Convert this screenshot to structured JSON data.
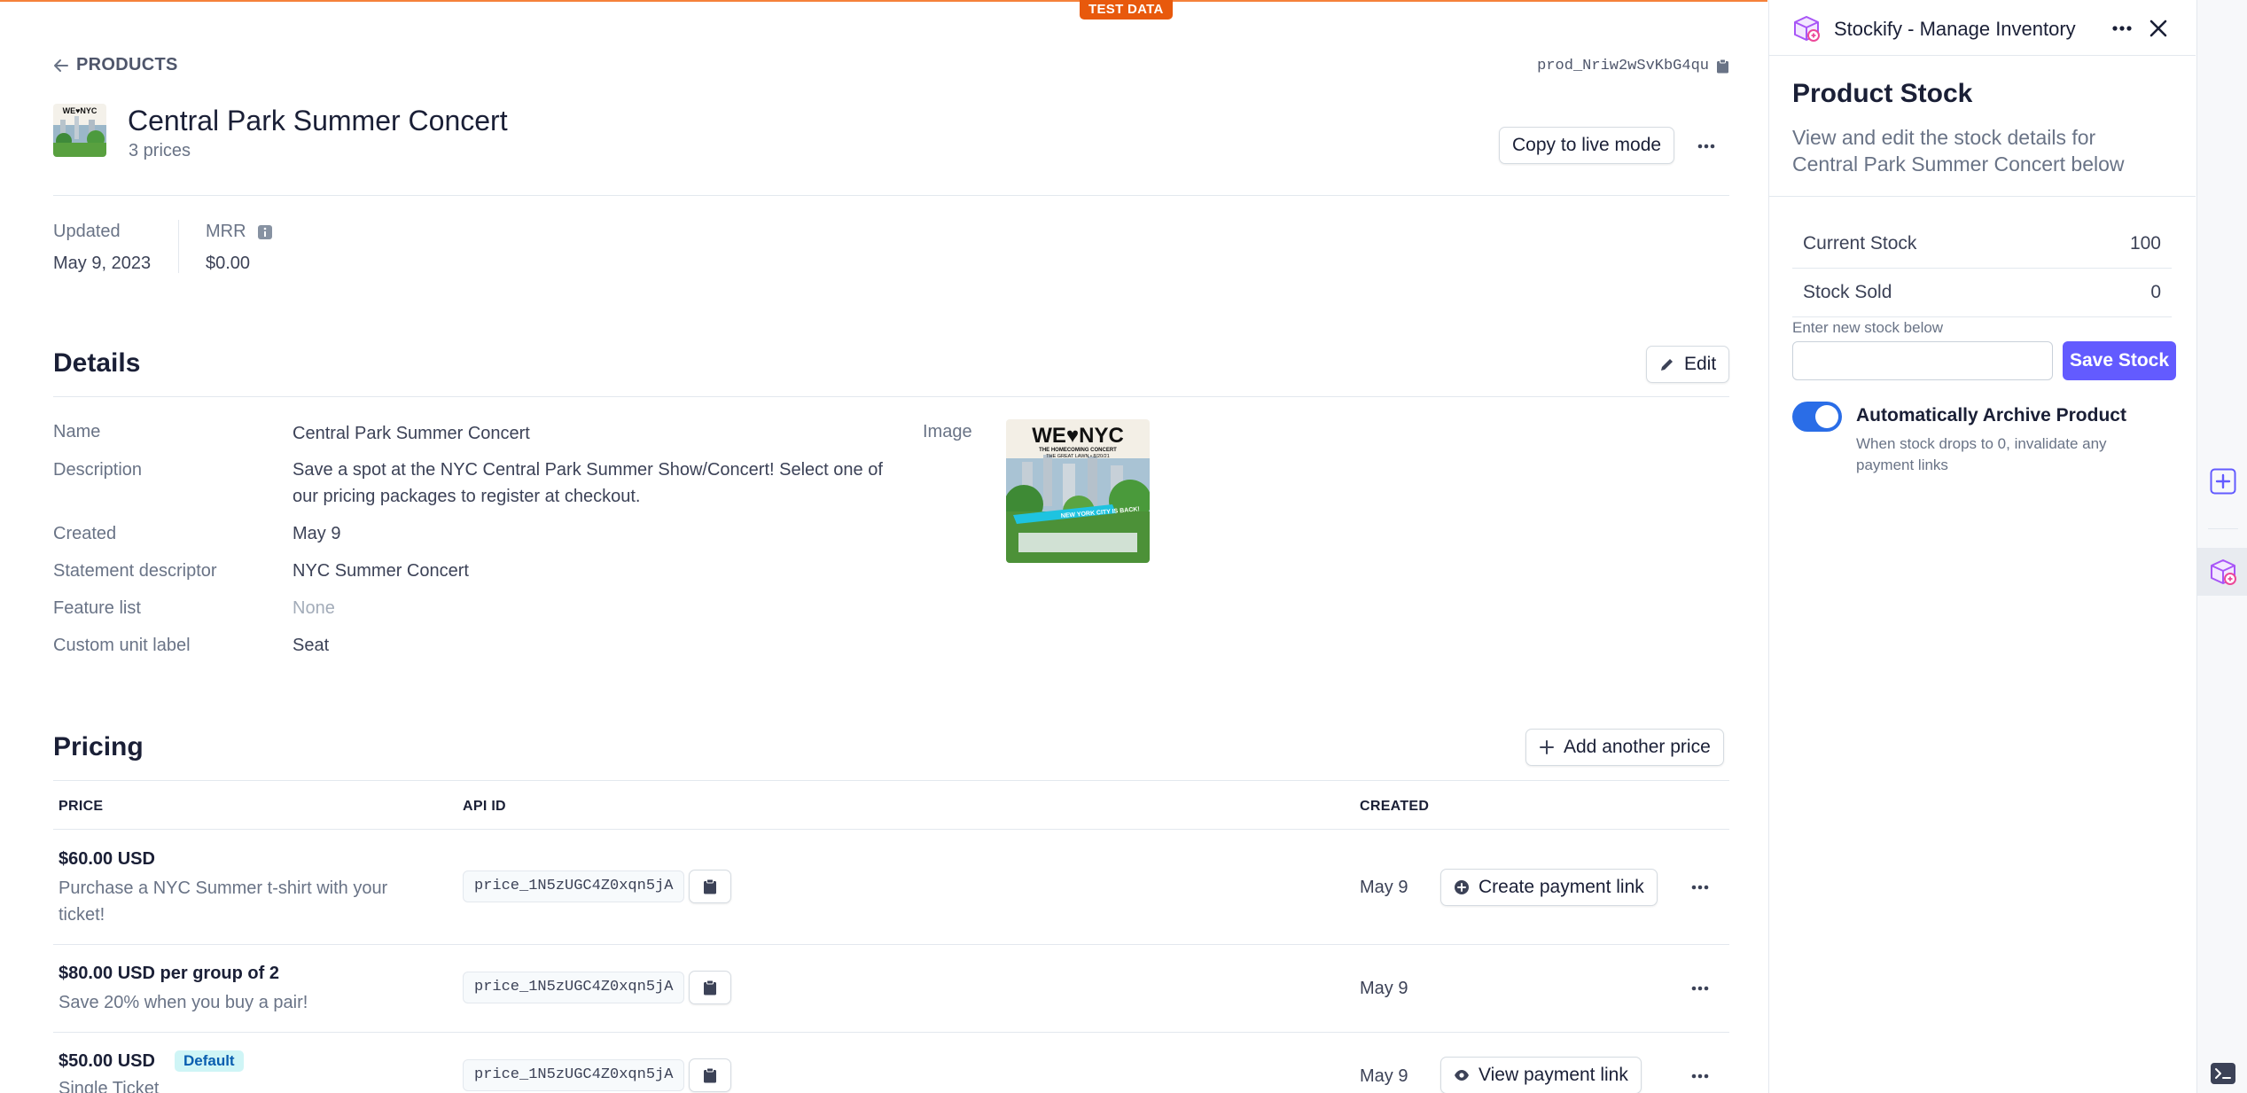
{
  "banner": {
    "label": "TEST DATA"
  },
  "breadcrumb": {
    "label": "PRODUCTS"
  },
  "product": {
    "id": "prod_Nriw2wSvKbG4qu",
    "name": "Central Park Summer Concert",
    "price_count": "3 prices",
    "copy_button": "Copy to live mode"
  },
  "meta": {
    "updated_label": "Updated",
    "updated_value": "May 9, 2023",
    "mrr_label": "MRR",
    "mrr_value": "$0.00"
  },
  "details": {
    "title": "Details",
    "edit_button": "Edit",
    "image_label": "Image",
    "fields": [
      {
        "label": "Name",
        "value": "Central Park Summer Concert"
      },
      {
        "label": "Description",
        "value": "Save a spot at the NYC Central Park Summer Show/Concert! Select one of our pricing packages to register at checkout."
      },
      {
        "label": "Created",
        "value": "May 9"
      },
      {
        "label": "Statement descriptor",
        "value": "NYC Summer Concert"
      },
      {
        "label": "Feature list",
        "value": "None"
      },
      {
        "label": "Custom unit label",
        "value": "Seat"
      }
    ],
    "poster": {
      "headline": "WE♥NYC",
      "line1": "THE HOMECOMING CONCERT",
      "line2": "THE GREAT LAWN • 8/20/21",
      "banner": "NEW YORK CITY IS BACK!"
    }
  },
  "pricing": {
    "title": "Pricing",
    "add_button": "Add another price",
    "columns": {
      "price": "PRICE",
      "api_id": "API ID",
      "created": "CREATED"
    },
    "rows": [
      {
        "price": "$60.00 USD",
        "desc": "Purchase a NYC Summer t-shirt with your ticket!",
        "api_id": "price_1N5zUGC4Z0xqn5jA",
        "created": "May 9",
        "action": "Create payment link"
      },
      {
        "price": "$80.00 USD per group of 2",
        "desc": "Save 20% when you buy a pair!",
        "api_id": "price_1N5zUGC4Z0xqn5jA",
        "created": "May 9",
        "action": ""
      },
      {
        "price": "$50.00 USD",
        "badge": "Default",
        "desc": "Single Ticket",
        "api_id": "price_1N5zUGC4Z0xqn5jA",
        "created": "May 9",
        "action": "View payment link"
      }
    ]
  },
  "panel": {
    "app_name": "Stockify - Manage Inventory",
    "title": "Product Stock",
    "description": "View and edit the stock details for Central Park Summer Concert below",
    "current_stock_label": "Current Stock",
    "current_stock_value": "100",
    "stock_sold_label": "Stock Sold",
    "stock_sold_value": "0",
    "new_stock_label": "Enter new stock below",
    "new_stock_value": "",
    "save_button": "Save Stock",
    "archive_toggle_label": "Automatically Archive Product",
    "archive_toggle_on": true,
    "archive_help": "When stock drops to 0, invalidate any payment links"
  },
  "colors": {
    "accent": "#635bff",
    "toggle": "#2a6de7",
    "test_banner": "#e8590c"
  }
}
